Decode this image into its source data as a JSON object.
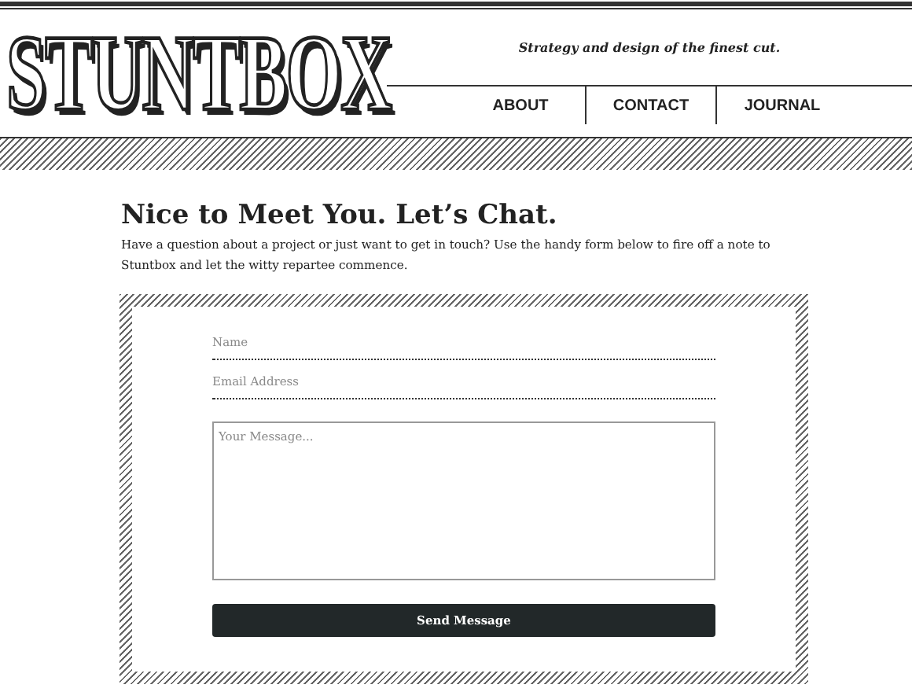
{
  "header": {
    "logo": "STUNTBOX",
    "tagline": "Strategy and design of the finest cut."
  },
  "nav": [
    {
      "label": "ABOUT"
    },
    {
      "label": "CONTACT"
    },
    {
      "label": "JOURNAL"
    }
  ],
  "heading": "Nice to Meet You. Let’s Chat.",
  "intro": "Have a question about a project or just want to get in touch? Use the handy form below to fire off a note to Stuntbox and let the witty repartee commence.",
  "form": {
    "fields": [
      {
        "placeholder": "Name"
      },
      {
        "placeholder": "Email Address"
      }
    ],
    "message": {
      "placeholder": "Your Message..."
    },
    "button": "Send Message"
  }
}
